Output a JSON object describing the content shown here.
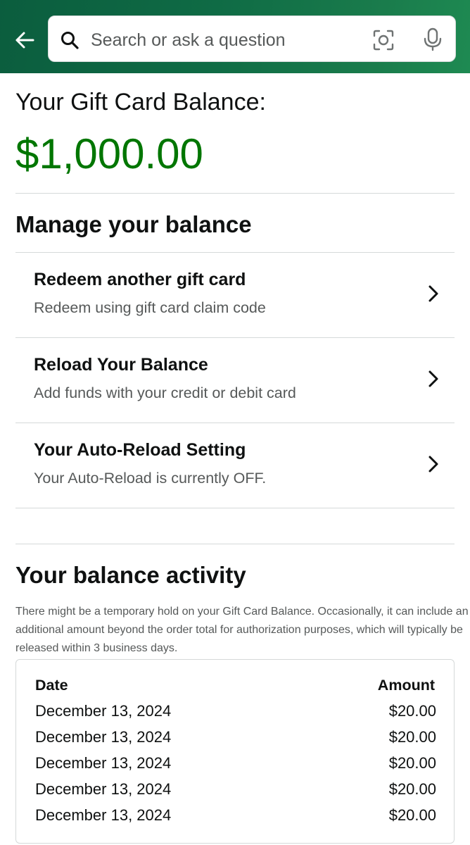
{
  "header": {
    "back_icon": "back-arrow-icon",
    "search": {
      "placeholder": "Search or ask a question",
      "value": "",
      "search_icon": "search-icon",
      "camera_icon": "camera-lens-icon",
      "mic_icon": "microphone-icon"
    },
    "brand_color": "#0f6b45"
  },
  "balance": {
    "label": "Your Gift Card Balance:",
    "amount": "$1,000.00",
    "amount_color": "#007600"
  },
  "manage": {
    "title": "Manage your balance",
    "items": [
      {
        "title": "Redeem another gift card",
        "subtitle": "Redeem using gift card claim code",
        "icon": "chevron-right-icon"
      },
      {
        "title": "Reload Your Balance",
        "subtitle": "Add funds with your credit or debit card",
        "icon": "chevron-right-icon"
      },
      {
        "title": "Your Auto-Reload Setting",
        "subtitle": "Your Auto-Reload is currently OFF.",
        "icon": "chevron-right-icon"
      }
    ]
  },
  "activity": {
    "title": "Your balance activity",
    "notice": "There might be a temporary hold on your Gift Card Balance. Occasionally, it can include an additional amount beyond the order total for authorization purposes, which will typically be released within 3 business days.",
    "columns": {
      "date": "Date",
      "amount": "Amount"
    },
    "rows": [
      {
        "date": "December 13, 2024",
        "amount": "$20.00"
      },
      {
        "date": "December 13, 2024",
        "amount": "$20.00"
      },
      {
        "date": "December 13, 2024",
        "amount": "$20.00"
      },
      {
        "date": "December 13, 2024",
        "amount": "$20.00"
      },
      {
        "date": "December 13, 2024",
        "amount": "$20.00"
      }
    ]
  }
}
